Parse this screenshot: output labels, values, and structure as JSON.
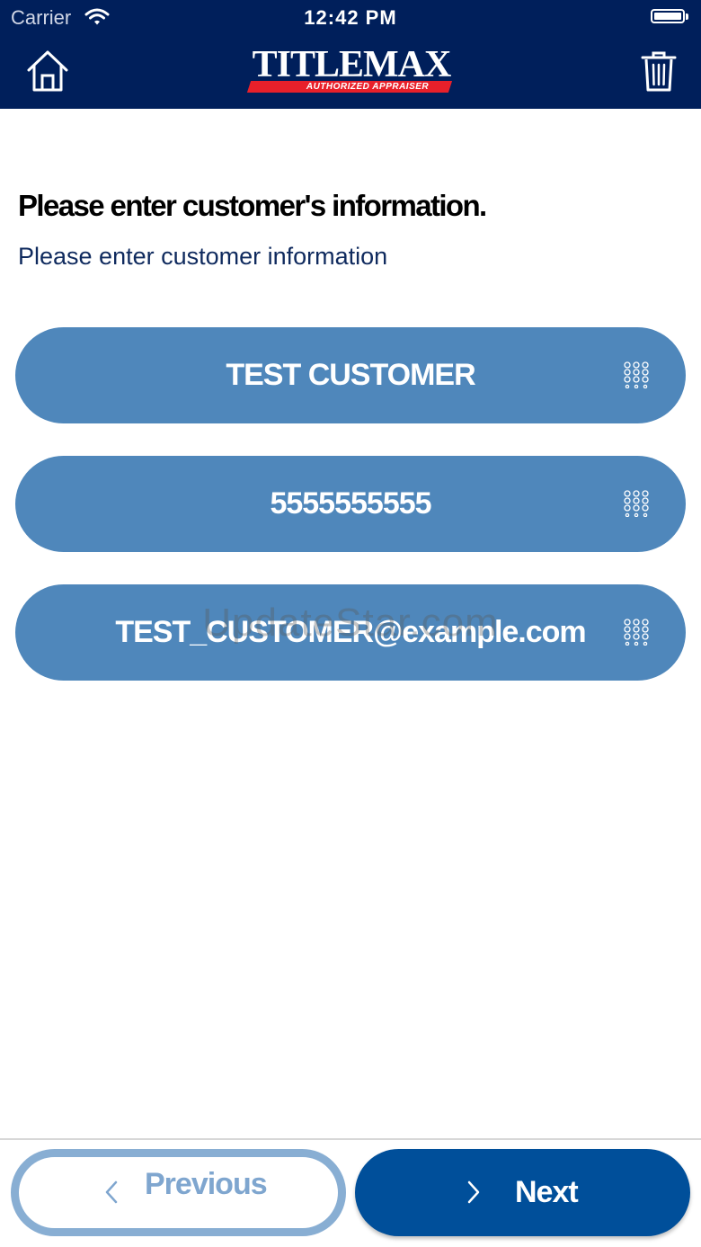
{
  "status_bar": {
    "carrier": "Carrier",
    "time": "12:42 PM"
  },
  "header": {
    "logo_text": "TITLEMAX",
    "logo_subtitle": "AUTHORIZED APPRAISER",
    "home_icon": "home-icon",
    "trash_icon": "trash-icon"
  },
  "main": {
    "heading": "Please enter customer's information.",
    "subheading": "Please enter customer information",
    "fields": [
      {
        "value": "TEST CUSTOMER",
        "icon": "keypad-icon"
      },
      {
        "value": "5555555555",
        "icon": "keypad-icon"
      },
      {
        "value": "TEST_CUSTOMER@example.com",
        "icon": "keypad-icon"
      }
    ],
    "watermark": "UpdateStar.com"
  },
  "footer": {
    "previous_label": "Previous",
    "next_label": "Next"
  },
  "colors": {
    "header_bg": "#001f5b",
    "field_bg": "#4f87bb",
    "next_bg": "#004f9a",
    "prev_border": "#88aed3",
    "logo_red": "#e8202a"
  }
}
